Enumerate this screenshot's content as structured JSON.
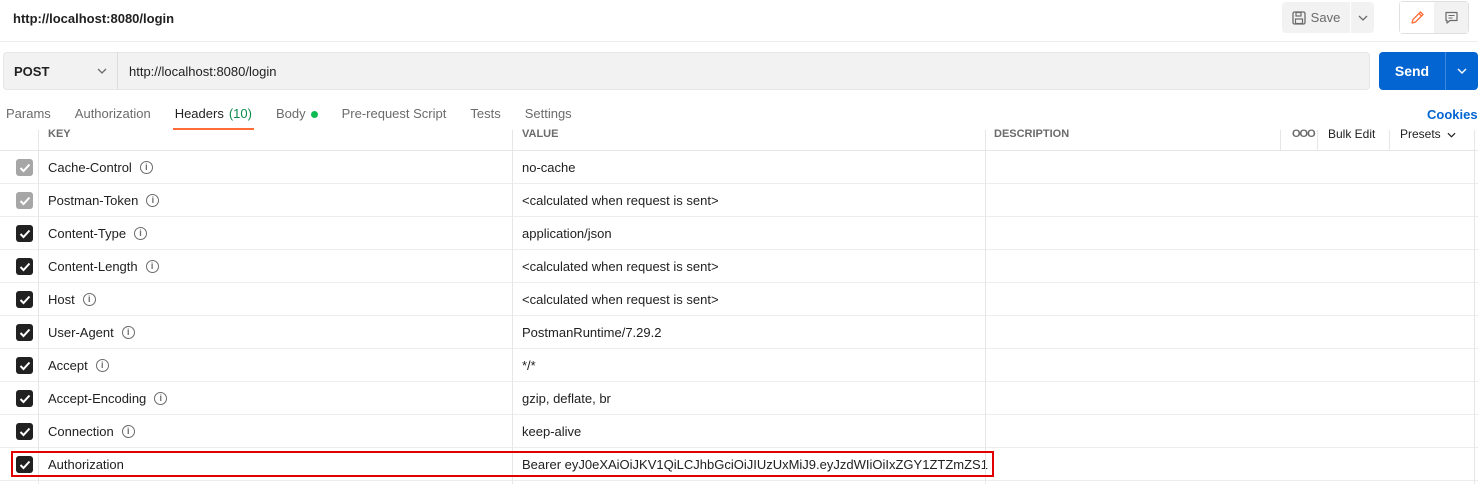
{
  "titlebar": {
    "title": "http://localhost:8080/login",
    "save_label": "Save",
    "save_icon": "floppy-icon",
    "edit_icon": "pencil-icon",
    "comment_icon": "comment-icon"
  },
  "request": {
    "method": "POST",
    "url": "http://localhost:8080/login",
    "send_label": "Send"
  },
  "tabs": [
    {
      "label": "Params",
      "count": ""
    },
    {
      "label": "Authorization",
      "count": ""
    },
    {
      "label": "Headers",
      "count": "(10)"
    },
    {
      "label": "Body",
      "count": ""
    },
    {
      "label": "Pre-request Script",
      "count": ""
    },
    {
      "label": "Tests",
      "count": ""
    },
    {
      "label": "Settings",
      "count": ""
    }
  ],
  "active_tab": "Headers",
  "cookies_label": "Cookies",
  "table": {
    "columns": {
      "key": "KEY",
      "value": "VALUE",
      "description": "DESCRIPTION"
    },
    "more_label": "ooo",
    "bulk_edit_label": "Bulk Edit",
    "presets_label": "Presets",
    "rows": [
      {
        "key": "Cache-Control",
        "value": "no-cache",
        "checked": "auto",
        "info": true
      },
      {
        "key": "Postman-Token",
        "value": "<calculated when request is sent>",
        "checked": "auto",
        "info": true
      },
      {
        "key": "Content-Type",
        "value": "application/json",
        "checked": "on",
        "info": true
      },
      {
        "key": "Content-Length",
        "value": "<calculated when request is sent>",
        "checked": "on",
        "info": true
      },
      {
        "key": "Host",
        "value": "<calculated when request is sent>",
        "checked": "on",
        "info": true
      },
      {
        "key": "User-Agent",
        "value": "PostmanRuntime/7.29.2",
        "checked": "on",
        "info": true
      },
      {
        "key": "Accept",
        "value": "*/*",
        "checked": "on",
        "info": true
      },
      {
        "key": "Accept-Encoding",
        "value": "gzip, deflate, br",
        "checked": "on",
        "info": true
      },
      {
        "key": "Connection",
        "value": "keep-alive",
        "checked": "on",
        "info": true
      },
      {
        "key": "Authorization",
        "value": "Bearer eyJ0eXAiOiJKV1QiLCJhbGciOiJIUzUxMiJ9.eyJzdWIiOiIxZGY1ZTZmZS1",
        "checked": "on",
        "info": false
      }
    ]
  },
  "colors": {
    "accent_send": "#0265d2",
    "tab_underline": "#ff6c37",
    "body_dot": "#0cbb52",
    "highlight_box": "#e00000"
  }
}
